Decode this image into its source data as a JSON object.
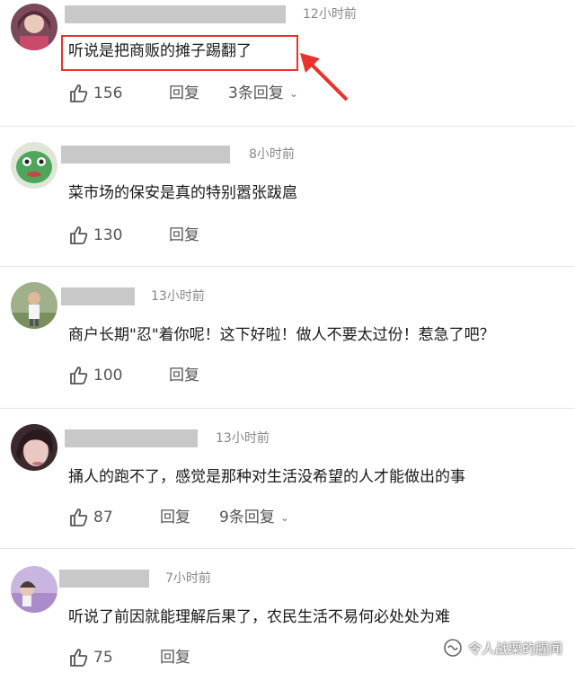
{
  "comments": [
    {
      "time": "12小时前",
      "text": "听说是把商贩的摊子踢翻了",
      "likes": "156",
      "reply_label": "回复",
      "more_replies": "3条回复"
    },
    {
      "time": "8小时前",
      "text": "菜市场的保安是真的特别嚣张跋扈",
      "likes": "130",
      "reply_label": "回复"
    },
    {
      "time": "13小时前",
      "text": "商户长期\"忍\"着你呢！这下好啦！做人不要太过份！惹急了吧？",
      "likes": "100",
      "reply_label": "回复"
    },
    {
      "time": "13小时前",
      "text": "捅人的跑不了，感觉是那种对生活没希望的人才能做出的事",
      "likes": "87",
      "reply_label": "回复",
      "more_replies": "9条回复"
    },
    {
      "time": "7小时前",
      "text": "听说了前因就能理解后果了，农民生活不易何必处处为难",
      "likes": "75",
      "reply_label": "回复"
    }
  ],
  "watermark": "令人战栗的腥闻",
  "colors": {
    "highlight": "#e8322c",
    "name_placeholder": "#c8c8c8"
  }
}
